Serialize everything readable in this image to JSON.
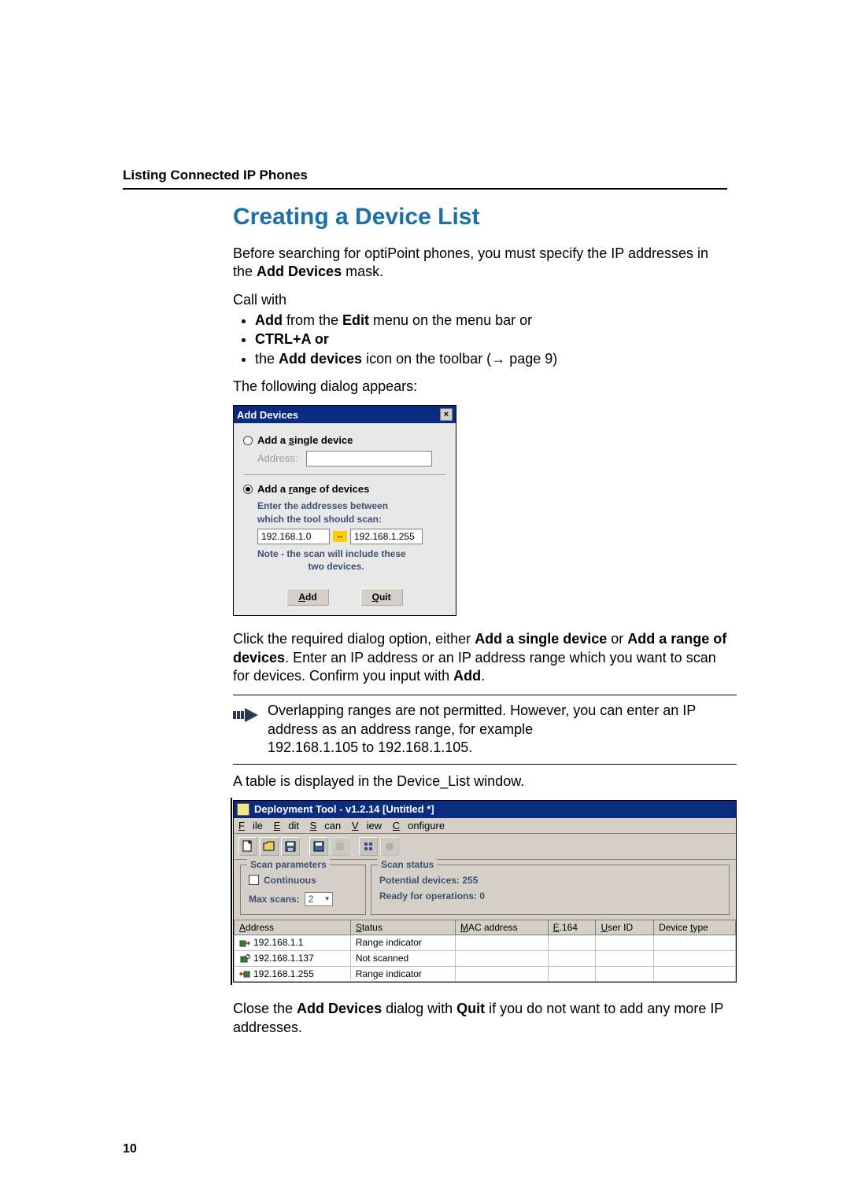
{
  "header": {
    "title": "Listing Connected IP Phones"
  },
  "section": {
    "h1": "Creating a Device List",
    "intro_1": "Before searching for optiPoint phones, you must specify the IP addresses in the ",
    "intro_1_bold": "Add Devices",
    "intro_1_tail": " mask.",
    "call_with": "Call with",
    "bullets": [
      {
        "pre": "",
        "bold1": "Add",
        "mid": " from the ",
        "bold2": "Edit",
        "tail": " menu on the menu bar or"
      },
      {
        "pre": "",
        "bold1": "CTRL+A or",
        "mid": "",
        "bold2": "",
        "tail": ""
      },
      {
        "pre": "the ",
        "bold1": "Add devices",
        "mid": " icon on the toolbar (",
        "arrow": "→",
        "tail": " page 9)"
      }
    ],
    "following_dialog": "The following dialog appears:"
  },
  "dialog": {
    "title": "Add Devices",
    "radio_single": "Add a single device",
    "addr_label": "Address:",
    "radio_range": "Add a range of devices",
    "range_intro_1": "Enter the addresses between",
    "range_intro_2": "which the tool should scan:",
    "ip_from": "192.168.1.0",
    "ip_to": "192.168.1.255",
    "note_line": "Note - the scan will include these",
    "note_line2": "two devices.",
    "btn_add": "Add",
    "btn_quit": "Quit"
  },
  "after_dialog": {
    "click_text_1": "Click the required dialog option, either ",
    "bold1": "Add a single device",
    "mid1": " or ",
    "bold2": "Add a range of devices",
    "mid2": ". Enter an IP address or an IP address range which you want to scan for devices. Confirm you input with ",
    "bold3": "Add",
    "tail": "."
  },
  "note": {
    "line1": "Overlapping ranges are not permitted. However, you can enter an IP address as an address range, for example",
    "line2": "192.168.1.105 to 192.168.1.105."
  },
  "table_intro": "A table is displayed in the Device_List window.",
  "window": {
    "title": "Deployment Tool - v1.2.14  [Untitled *]",
    "menu": {
      "file": "File",
      "edit": "Edit",
      "scan": "Scan",
      "view": "View",
      "configure": "Configure"
    },
    "scan_params_title": "Scan parameters",
    "continuous": "Continuous",
    "max_scans_label": "Max scans:",
    "max_scans_value": "2",
    "scan_status_title": "Scan status",
    "potential_devices": "Potential devices: 255",
    "ready_ops": "Ready for operations: 0",
    "table": {
      "headers": {
        "address": "Address",
        "status": "Status",
        "mac": "MAC address",
        "e164": "E.164",
        "userid": "User ID",
        "type": "Device type"
      },
      "rows": [
        {
          "address": "192.168.1.1",
          "status": "Range indicator"
        },
        {
          "address": "192.168.1.137",
          "status": "Not scanned"
        },
        {
          "address": "192.168.1.255",
          "status": "Range indicator"
        }
      ]
    }
  },
  "closing": {
    "pre": "Close the ",
    "bold1": "Add Devices",
    "mid": " dialog with ",
    "bold2": "Quit",
    "tail": " if you do not want to add any more IP addresses."
  },
  "page_number": "10"
}
